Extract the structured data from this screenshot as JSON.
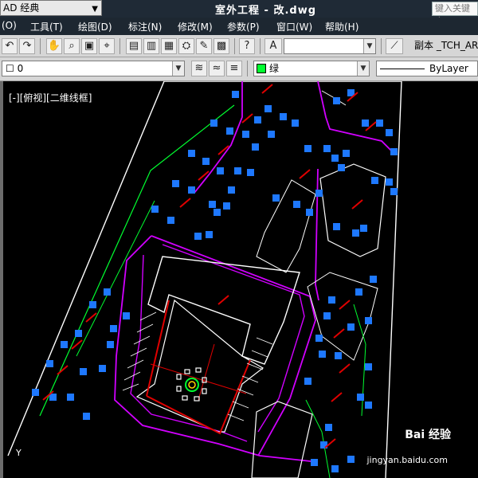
{
  "window": {
    "workspace": "AD 经典",
    "title": "室外工程 - 改.dwg",
    "search_placeholder": "键入关键字"
  },
  "menu": [
    "(O)",
    "工具(T)",
    "绘图(D)",
    "标注(N)",
    "修改(M)",
    "参数(P)",
    "窗口(W)",
    "帮助(H)"
  ],
  "toolbar": {
    "text_style_value": "",
    "dim_style_label": "副本 _TCH_ARC"
  },
  "layer_bar": {
    "layer_value": "0",
    "color_value": "绿",
    "linetype_value": "ByLayer"
  },
  "viewport": {
    "label": "[-][俯视][二维线框]",
    "ucs_label": "Y"
  },
  "watermark": {
    "brand": "Bai 经验",
    "url": "jingyan.baidu.com"
  },
  "colors": {
    "background": "#000000",
    "magenta": "#d100ff",
    "red": "#e00000",
    "green": "#00ff30",
    "blue": "#1e78ff",
    "white": "#ffffff"
  }
}
